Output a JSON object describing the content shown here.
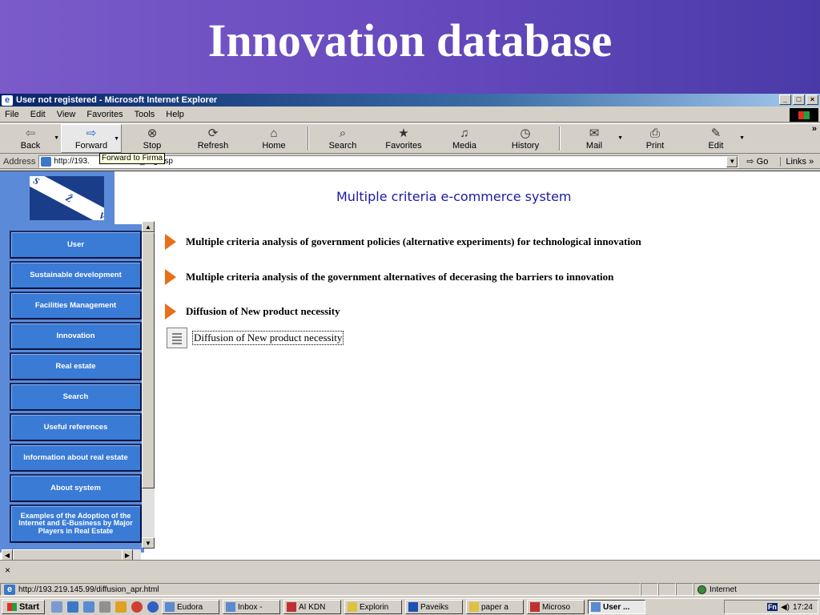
{
  "slide": {
    "title": "Innovation database"
  },
  "window": {
    "title": "User not registered - Microsoft Internet Explorer",
    "controls": [
      "_",
      "□",
      "×"
    ]
  },
  "menu": [
    "File",
    "Edit",
    "View",
    "Favorites",
    "Tools",
    "Help"
  ],
  "toolbar": [
    {
      "label": "Back",
      "icon": "back-arrow-icon"
    },
    {
      "label": "Forward",
      "icon": "forward-arrow-icon"
    },
    {
      "label": "Stop",
      "icon": "stop-icon"
    },
    {
      "label": "Refresh",
      "icon": "refresh-icon"
    },
    {
      "label": "Home",
      "icon": "home-icon"
    },
    {
      "label": "Search",
      "icon": "search-icon"
    },
    {
      "label": "Favorites",
      "icon": "favorites-icon"
    },
    {
      "label": "Media",
      "icon": "media-icon"
    },
    {
      "label": "History",
      "icon": "history-icon"
    },
    {
      "label": "Mail",
      "icon": "mail-icon"
    },
    {
      "label": "Print",
      "icon": "print-icon"
    },
    {
      "label": "Edit",
      "icon": "edit-icon"
    }
  ],
  "tooltip": "Forward to Firma",
  "address": {
    "label": "Address",
    "url": "http://193.",
    "url_tail": "lt_eng.asp",
    "go": "Go",
    "links": "Links"
  },
  "sidebar": {
    "items": [
      "User",
      "Sustainable development",
      "Facilities Management",
      "Innovation",
      "Real estate",
      "Search",
      "Useful references",
      "Information about real estate",
      "About system",
      "Examples of the Adoption of the Internet and E-Business by Major Players in Real Estate"
    ]
  },
  "main": {
    "heading": "Multiple criteria e-commerce system",
    "links": [
      "Multiple criteria analysis of government policies (alternative experiments) for technological innovation",
      "Multiple criteria analysis of the government alternatives of decerasing the barriers to innovation",
      "Diffusion of New product necessity"
    ],
    "document_link": "Diffusion of New product necessity"
  },
  "findbar": {
    "close": "×"
  },
  "status": {
    "url": "http://193.219.145.99/diffusion_apr.html",
    "zone": "Internet"
  },
  "taskbar": {
    "start": "Start",
    "tasks": [
      "Eudora",
      "Inbox -",
      "AI KDN",
      "Explorin",
      "Paveiks",
      "paper a",
      "Microso",
      "User ..."
    ],
    "clock": "17:24",
    "tray_lang": "Fn"
  },
  "colors": {
    "banner": "#6a4cc0",
    "nav_button": "#3a7bd5",
    "nav_panel": "#5b8bd8",
    "heading": "#1a1aa8",
    "arrow": "#e8701a"
  }
}
